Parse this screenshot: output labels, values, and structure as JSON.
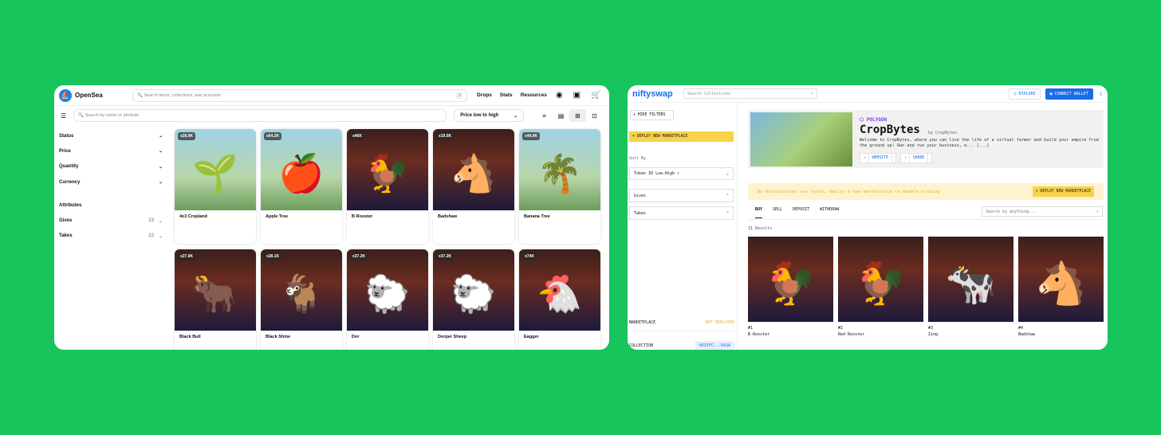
{
  "opensea": {
    "brand": "OpenSea",
    "search_placeholder": "Search items, collections, and accounts",
    "search_shortcut": "/",
    "nav": [
      "Drops",
      "Stats",
      "Resources"
    ],
    "filter_placeholder": "Search by name or attribute",
    "sort_label": "Price low to high",
    "filters": [
      {
        "label": "Status"
      },
      {
        "label": "Price"
      },
      {
        "label": "Quantity"
      },
      {
        "label": "Currency"
      }
    ],
    "attributes_heading": "Attributes",
    "attributes": [
      {
        "label": "Gives",
        "count": "23"
      },
      {
        "label": "Takes",
        "count": "22"
      }
    ],
    "items": [
      {
        "name": "4x3 Cropland",
        "badge": "x28.9K",
        "icon": "🌱",
        "bg": "sky"
      },
      {
        "name": "Apple Tree",
        "badge": "x64.2K",
        "icon": "🍎",
        "bg": "sky"
      },
      {
        "name": "B Rooster",
        "badge": "x46K",
        "icon": "🐓",
        "bg": "barn"
      },
      {
        "name": "Badshaw",
        "badge": "x19.5K",
        "icon": "🐴",
        "bg": "barn"
      },
      {
        "name": "Banana Tree",
        "badge": "x44.9K",
        "icon": "🌴",
        "bg": "sky"
      },
      {
        "name": "Black Bull",
        "badge": "x27.9K",
        "icon": "🐂",
        "bg": "barn"
      },
      {
        "name": "Black Shine",
        "badge": "x28.1K",
        "icon": "🐐",
        "bg": "barn"
      },
      {
        "name": "Dor",
        "badge": "x37.2K",
        "icon": "🐑",
        "bg": "barn"
      },
      {
        "name": "Dorper Sheep",
        "badge": "x37.2K",
        "icon": "🐑",
        "bg": "barn"
      },
      {
        "name": "Eagger",
        "badge": "x74K",
        "icon": "🐔",
        "bg": "barn"
      }
    ]
  },
  "niftyswap": {
    "brand": "niftyswap",
    "search_placeholder": "Search Collections",
    "explore": "EXPLORE",
    "connect": "CONNECT WALLET",
    "hide_filters": "HIDE FILTERS",
    "deploy": "+ DEPLOY NEW MARKETPLACE",
    "sort_by": "Sort By",
    "sort_value": "Token ID Low-High ↑",
    "gives": "Gives",
    "takes": "Takes",
    "marketplace_label": "MARKETPLACE",
    "marketplace_status": "NOT DEPLOYED",
    "collection_label": "COLLECTION",
    "collection_addr": "0X37FC...642A",
    "chain": "POLYGON",
    "title": "CropBytes",
    "by": "by CropBytes",
    "description": "Welcome to CropBytes, where you can live the life of a virtual farmer and build your empire from the ground up! Own and run your business, e... [...]",
    "website": "WEBSITE",
    "share": "SHARE",
    "banner": "No marketplaces are found, deploy a new marketplace to enable trading",
    "banner_button": "+ DEPLOY NEW MARKETPLACE",
    "tabs": [
      "BUY",
      "SELL",
      "DEPOSIT",
      "WITHDRAW"
    ],
    "search2_placeholder": "Search by anything...",
    "results": "31 Results",
    "items": [
      {
        "num": "#1",
        "name": "B Rooster",
        "icon": "🐓"
      },
      {
        "num": "#2",
        "name": "Red Rooster",
        "icon": "🐓"
      },
      {
        "num": "#3",
        "name": "Zing",
        "icon": "🐄"
      },
      {
        "num": "#4",
        "name": "Badshaw",
        "icon": "🐴"
      }
    ]
  }
}
